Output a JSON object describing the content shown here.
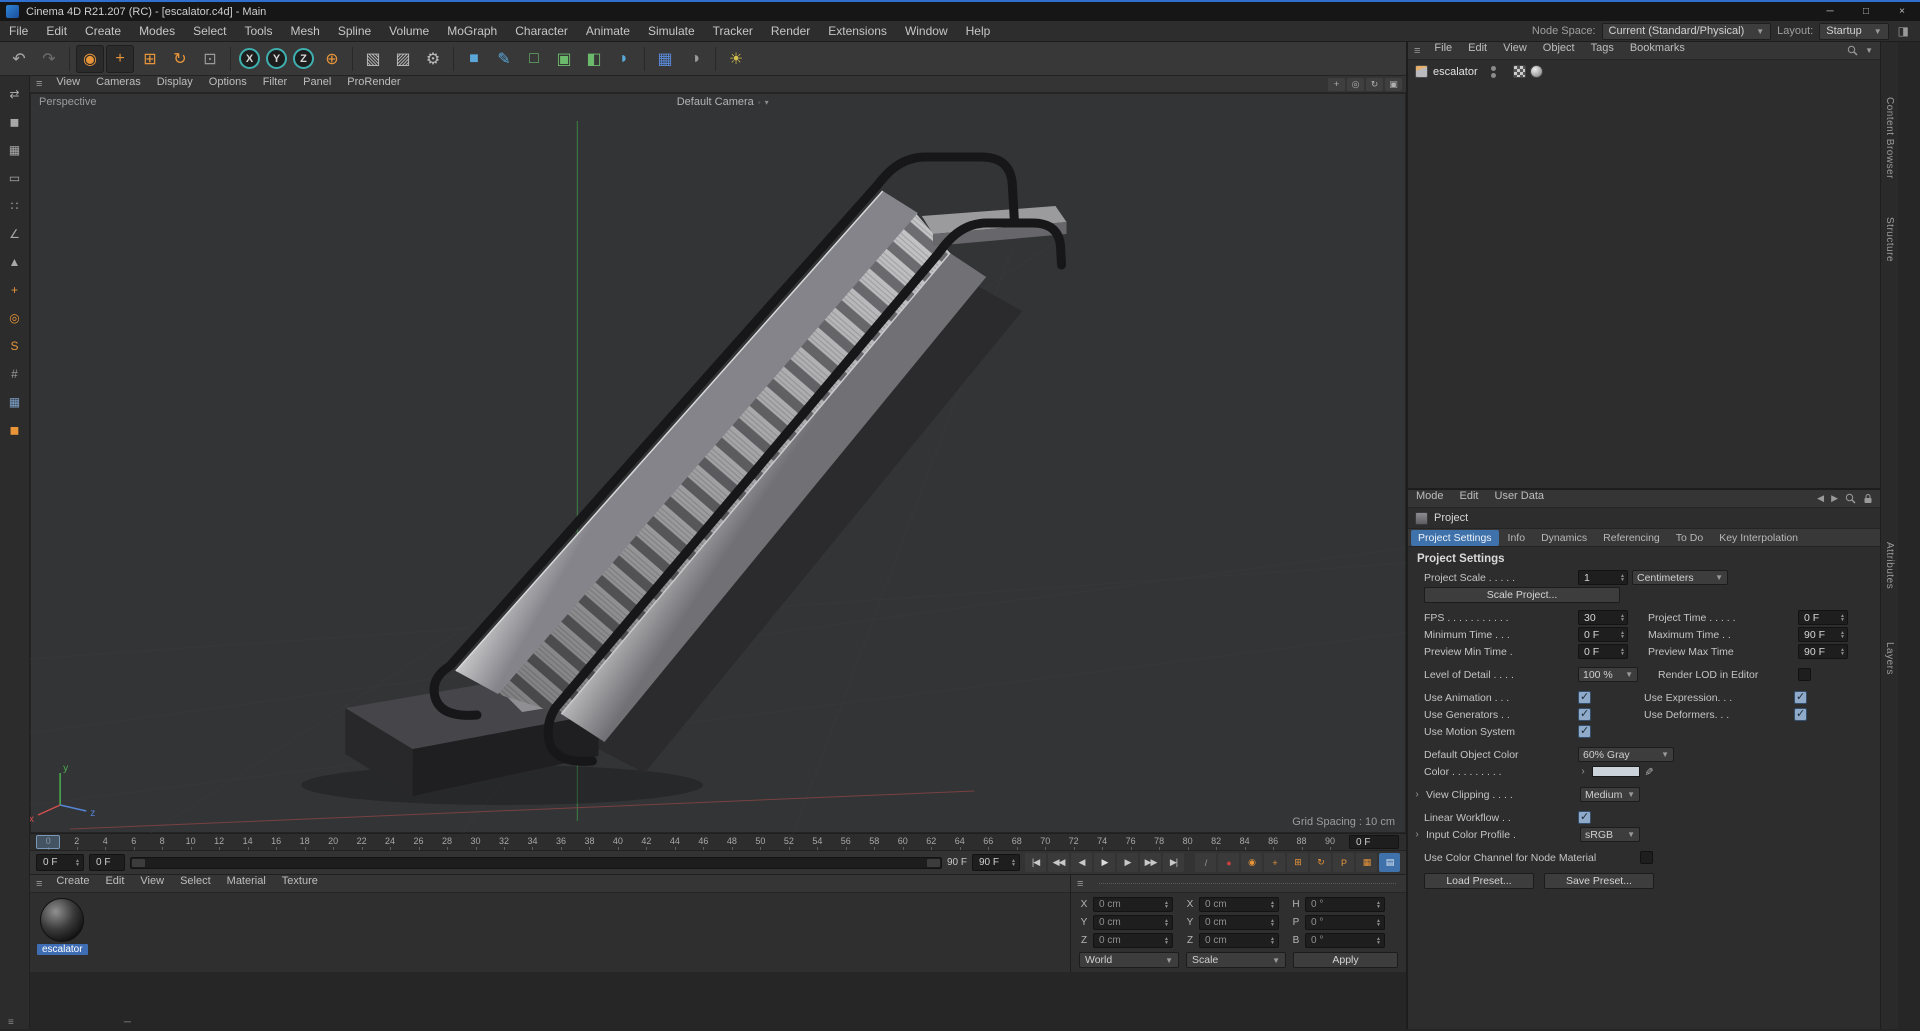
{
  "colors": {
    "accent_orange": "#e8953a",
    "accent_blue": "#3f72ab",
    "selection_blue": "#3e6db3",
    "check_blue": "#8fabc9",
    "axis_x_red": "#d05050",
    "axis_y_green": "#4caf50",
    "axis_z_blue": "#5585d5"
  },
  "window": {
    "title": "Cinema 4D R21.207 (RC) - [escalator.c4d] - Main",
    "minimize": "─",
    "maximize": "□",
    "close": "×"
  },
  "menubar": {
    "items": [
      "File",
      "Edit",
      "Create",
      "Modes",
      "Select",
      "Tools",
      "Mesh",
      "Spline",
      "Volume",
      "MoGraph",
      "Character",
      "Animate",
      "Simulate",
      "Tracker",
      "Render",
      "Extensions",
      "Window",
      "Help"
    ],
    "node_space_label": "Node Space:",
    "node_space_value": "Current (Standard/Physical)",
    "layout_label": "Layout:",
    "layout_value": "Startup"
  },
  "toolbar": {
    "buttons": [
      {
        "name": "undo-button",
        "glyph": "↶",
        "fg": "#a9a9a9"
      },
      {
        "name": "redo-button",
        "glyph": "↷",
        "fg": "#6e6e6e"
      },
      {
        "sep": true
      },
      {
        "name": "live-selection-tool",
        "glyph": "◉",
        "fg": "#e8953a",
        "active": true
      },
      {
        "name": "move-tool",
        "glyph": "+",
        "fg": "#e8953a",
        "active": true
      },
      {
        "name": "scale-tool",
        "glyph": "⊞",
        "fg": "#e8953a"
      },
      {
        "name": "rotate-tool",
        "glyph": "↻",
        "fg": "#e8953a"
      },
      {
        "name": "recent-tool-button",
        "glyph": "⊡",
        "fg": "#9a9a9a"
      },
      {
        "sep": true
      },
      {
        "name": "x-axis-lock",
        "glyph": "X",
        "fg": "#d8d8d8",
        "ring": "#3fb0b0"
      },
      {
        "name": "y-axis-lock",
        "glyph": "Y",
        "fg": "#d8d8d8",
        "ring": "#3fb0b0"
      },
      {
        "name": "z-axis-lock",
        "glyph": "Z",
        "fg": "#d8d8d8",
        "ring": "#3fb0b0"
      },
      {
        "name": "coordinate-system-button",
        "glyph": "⊕",
        "fg": "#e8953a"
      },
      {
        "sep": true
      },
      {
        "name": "render-view-button",
        "glyph": "▧",
        "fg": "#bcbcbc"
      },
      {
        "name": "render-to-picture-viewer-button",
        "glyph": "▨",
        "fg": "#bcbcbc"
      },
      {
        "name": "render-settings-button",
        "glyph": "⚙",
        "fg": "#bcbcbc"
      },
      {
        "sep": true
      },
      {
        "name": "add-cube-button",
        "glyph": "■",
        "fg": "#5aa7d8"
      },
      {
        "name": "pen-tool-button",
        "glyph": "✎",
        "fg": "#5aa7d8"
      },
      {
        "name": "subdivision-surface-button",
        "glyph": "□",
        "fg": "#6cba6c"
      },
      {
        "name": "array-button",
        "glyph": "▣",
        "fg": "#6cba6c"
      },
      {
        "name": "symmetry-button",
        "glyph": "◧",
        "fg": "#6cba6c"
      },
      {
        "name": "bend-deformer-button",
        "glyph": "◗",
        "fg": "#5aa7d8"
      },
      {
        "sep": true
      },
      {
        "name": "floor-button",
        "glyph": "▦",
        "fg": "#5a8ad8"
      },
      {
        "name": "sky-button",
        "glyph": "◑",
        "fg": "#9a9a9a"
      },
      {
        "sep": true
      },
      {
        "name": "light-button",
        "glyph": "☀",
        "fg": "#d4c04e"
      }
    ]
  },
  "palette": {
    "buttons": [
      {
        "name": "make-editable-button",
        "glyph": "⇄",
        "fg": "#a8a8a8"
      },
      {
        "name": "model-mode-button",
        "glyph": "◼",
        "fg": "#a8a8a8"
      },
      {
        "name": "texture-mode-button",
        "glyph": "▦",
        "fg": "#a8a8a8"
      },
      {
        "name": "workplane-mode-button",
        "glyph": "▭",
        "fg": "#a8a8a8"
      },
      {
        "name": "points-mode-button",
        "glyph": "∷",
        "fg": "#a8a8a8"
      },
      {
        "name": "edges-mode-button",
        "glyph": "∠",
        "fg": "#a8a8a8"
      },
      {
        "name": "polygons-mode-button",
        "glyph": "▲",
        "fg": "#a8a8a8"
      },
      {
        "name": "enable-axis-button",
        "glyph": "+",
        "fg": "#e8953a"
      },
      {
        "name": "viewport-solo-button",
        "glyph": "◎",
        "fg": "#e8953a"
      },
      {
        "name": "snap-toggle-button",
        "glyph": "S",
        "fg": "#e8953a"
      },
      {
        "name": "grid-snap-button",
        "glyph": "#",
        "fg": "#9a9a9a"
      },
      {
        "name": "uv-mode-button",
        "glyph": "▦",
        "fg": "#7aa0c8"
      },
      {
        "name": "object-axis-button",
        "glyph": "◼",
        "fg": "#e8953a"
      }
    ]
  },
  "viewport": {
    "menus": [
      "View",
      "Cameras",
      "Display",
      "Options",
      "Filter",
      "Panel",
      "ProRender"
    ],
    "nav_icons": [
      {
        "name": "pan-view-icon",
        "glyph": "+"
      },
      {
        "name": "zoom-view-icon",
        "glyph": "◎"
      },
      {
        "name": "rotate-view-icon",
        "glyph": "↻"
      },
      {
        "name": "toggle-view-icon",
        "glyph": "▣"
      }
    ],
    "view_label": "Perspective",
    "camera_label": "Default Camera",
    "grid_spacing": "Grid Spacing : 10 cm",
    "axis_x": "x",
    "axis_y": "y",
    "axis_z": "z"
  },
  "timeline": {
    "ticks": [
      "0",
      "2",
      "4",
      "6",
      "8",
      "10",
      "12",
      "14",
      "16",
      "18",
      "20",
      "22",
      "24",
      "26",
      "28",
      "30",
      "32",
      "34",
      "36",
      "38",
      "40",
      "42",
      "44",
      "46",
      "48",
      "50",
      "52",
      "54",
      "56",
      "58",
      "60",
      "62",
      "64",
      "66",
      "68",
      "70",
      "72",
      "74",
      "76",
      "78",
      "80",
      "82",
      "84",
      "86",
      "88",
      "90"
    ],
    "current_frame": "0 F",
    "frame_field": "0 F",
    "range_start": "0 F",
    "range_end": "90 F",
    "max_field": "90 F",
    "transport": [
      {
        "name": "goto-start-button",
        "glyph": "|◀"
      },
      {
        "name": "previous-key-button",
        "glyph": "◀◀"
      },
      {
        "name": "previous-frame-button",
        "glyph": "◀"
      },
      {
        "name": "play-button",
        "glyph": "▶",
        "fg": "#dcdcdc"
      },
      {
        "name": "next-frame-button",
        "glyph": "▶"
      },
      {
        "name": "next-key-button",
        "glyph": "▶▶"
      },
      {
        "name": "goto-end-button",
        "glyph": "▶|"
      }
    ],
    "record": [
      {
        "name": "keyframe-selection-button",
        "glyph": "/",
        "fg": "#9a9a9a"
      },
      {
        "name": "record-keyframe-button",
        "glyph": "●",
        "fg": "#c84040"
      },
      {
        "name": "autokeying-button",
        "glyph": "◉",
        "fg": "#e8953a"
      },
      {
        "name": "record-position-toggle",
        "glyph": "+",
        "fg": "#e8953a"
      },
      {
        "name": "record-scale-toggle",
        "glyph": "⊞",
        "fg": "#e8953a"
      },
      {
        "name": "record-rotation-toggle",
        "glyph": "↻",
        "fg": "#e8953a"
      },
      {
        "name": "record-parameter-toggle",
        "glyph": "P",
        "fg": "#e8953a"
      },
      {
        "name": "record-pla-toggle",
        "glyph": "▦",
        "fg": "#e8953a"
      },
      {
        "name": "timeline-options-button",
        "glyph": "▤",
        "fg": "#dfe9f4",
        "bg": "#3f72ab"
      }
    ]
  },
  "materials": {
    "menus": [
      "Create",
      "Edit",
      "View",
      "Select",
      "Material",
      "Texture"
    ],
    "material_name": "escalator"
  },
  "coordinates": {
    "position": [
      {
        "l": "X",
        "v": "0 cm"
      },
      {
        "l": "Y",
        "v": "0 cm"
      },
      {
        "l": "Z",
        "v": "0 cm"
      }
    ],
    "size": [
      {
        "l": "X",
        "v": "0 cm"
      },
      {
        "l": "Y",
        "v": "0 cm"
      },
      {
        "l": "Z",
        "v": "0 cm"
      }
    ],
    "rotation": [
      {
        "l": "H",
        "v": "0 °"
      },
      {
        "l": "P",
        "v": "0 °"
      },
      {
        "l": "B",
        "v": "0 °"
      }
    ],
    "mode_world": "World",
    "mode_scale": "Scale",
    "apply_label": "Apply"
  },
  "object_manager": {
    "menus": [
      "File",
      "Edit",
      "View",
      "Object",
      "Tags",
      "Bookmarks"
    ],
    "object_name": "escalator"
  },
  "attributes": {
    "menus": [
      "Mode",
      "Edit",
      "User Data"
    ],
    "object_label": "Project",
    "tabs": [
      {
        "label": "Project Settings",
        "active": true
      },
      {
        "label": "Info"
      },
      {
        "label": "Dynamics"
      },
      {
        "label": "Referencing"
      },
      {
        "label": "To Do"
      },
      {
        "label": "Key Interpolation"
      }
    ],
    "heading": "Project Settings",
    "project_scale_label": "Project Scale . . . . .",
    "project_scale_value": "1",
    "project_scale_unit": "Centimeters",
    "scale_project_button": "Scale Project...",
    "fps_label": "FPS . . . . . . . . . . .",
    "fps_value": "30",
    "project_time_label": "Project Time . . . . .",
    "project_time_value": "0 F",
    "min_time_label": "Minimum Time . . .",
    "min_time_value": "0 F",
    "max_time_label": "Maximum Time . .",
    "max_time_value": "90 F",
    "preview_min_label": "Preview Min Time .",
    "preview_min_value": "0 F",
    "preview_max_label": "Preview Max Time",
    "preview_max_value": "90 F",
    "lod_label": "Level of Detail . . . .",
    "lod_value": "100 %",
    "render_lod_label": "Render LOD in Editor",
    "use_animation_label": "Use Animation . . .",
    "use_expression_label": "Use Expression. . .",
    "use_generators_label": "Use Generators . .",
    "use_deformers_label": "Use Deformers. . .",
    "use_motion_label": "Use Motion System",
    "default_color_label": "Default Object Color",
    "default_color_value": "60% Gray",
    "color_label": "Color . . . . . . . . .",
    "view_clipping_label": "View Clipping . . . .",
    "view_clipping_value": "Medium",
    "linear_workflow_label": "Linear Workflow . .",
    "input_profile_label": "Input Color Profile .",
    "input_profile_value": "sRGB",
    "node_material_label": "Use Color Channel for Node Material",
    "load_preset_button": "Load Preset...",
    "save_preset_button": "Save Preset...",
    "checks": {
      "render_lod": false,
      "use_animation": true,
      "use_expression": true,
      "use_generators": true,
      "use_deformers": true,
      "use_motion": true,
      "linear_workflow": true,
      "node_material": false
    }
  },
  "right_strip": {
    "labels": [
      "Content Browser",
      "Structure",
      "Attributes",
      "Layers"
    ]
  }
}
